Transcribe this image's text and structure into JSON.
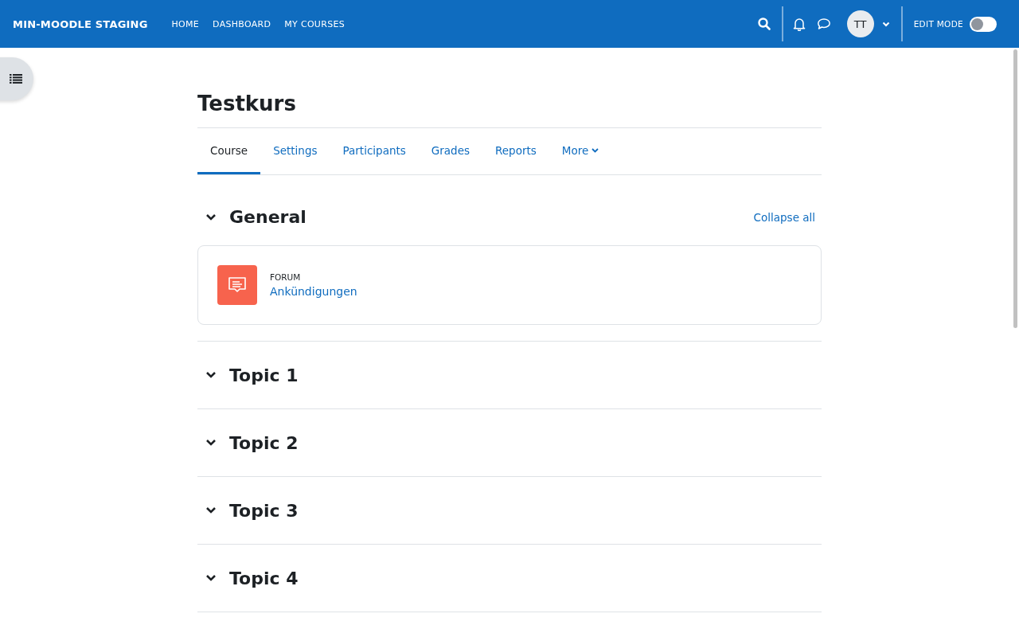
{
  "navbar": {
    "site_name": "MIN-MOODLE STAGING",
    "links": [
      "HOME",
      "DASHBOARD",
      "MY COURSES"
    ],
    "avatar": "TT",
    "edit_mode": {
      "label": "EDIT MODE",
      "on": false
    }
  },
  "course_title": "Testkurs",
  "tabs": [
    {
      "label": "Course",
      "selected": true,
      "kind": "tab"
    },
    {
      "label": "Settings",
      "selected": false,
      "kind": "tab"
    },
    {
      "label": "Participants",
      "selected": false,
      "kind": "tab"
    },
    {
      "label": "Grades",
      "selected": false,
      "kind": "tab"
    },
    {
      "label": "Reports",
      "selected": false,
      "kind": "tab"
    },
    {
      "label": "More",
      "selected": false,
      "kind": "menu"
    }
  ],
  "collapse_all": "Collapse all",
  "sections": [
    {
      "title": "General",
      "expanded": true,
      "activities": [
        {
          "type": "FORUM",
          "name": "Ankündigungen"
        }
      ]
    },
    {
      "title": "Topic 1",
      "expanded": true
    },
    {
      "title": "Topic 2",
      "expanded": true
    },
    {
      "title": "Topic 3",
      "expanded": true
    },
    {
      "title": "Topic 4",
      "expanded": true
    }
  ]
}
